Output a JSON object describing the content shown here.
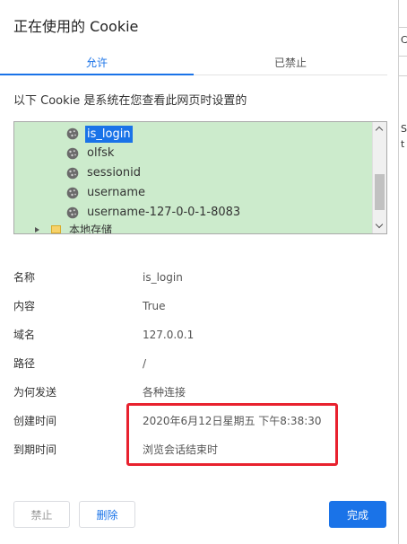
{
  "dialog": {
    "title": "正在使用的 Cookie",
    "tabs": [
      {
        "label": "允许",
        "active": true
      },
      {
        "label": "已禁止",
        "active": false
      }
    ],
    "description": "以下 Cookie 是系统在您查看此网页时设置的"
  },
  "cookie_tree": {
    "items": [
      {
        "label": "is_login",
        "selected": true,
        "icon": "cookie-icon"
      },
      {
        "label": "olfsk",
        "selected": false,
        "icon": "cookie-icon"
      },
      {
        "label": "sessionid",
        "selected": false,
        "icon": "cookie-icon"
      },
      {
        "label": "username",
        "selected": false,
        "icon": "cookie-icon"
      },
      {
        "label": "username-127-0-0-1-8083",
        "selected": false,
        "icon": "cookie-icon"
      }
    ],
    "folder": {
      "label": "本地存储",
      "icon": "folder-icon"
    }
  },
  "details": [
    {
      "key": "名称",
      "value": "is_login"
    },
    {
      "key": "内容",
      "value": "True"
    },
    {
      "key": "域名",
      "value": "127.0.0.1"
    },
    {
      "key": "路径",
      "value": "/"
    },
    {
      "key": "为何发送",
      "value": "各种连接"
    },
    {
      "key": "创建时间",
      "value": "2020年6月12日星期五 下午8:38:30"
    },
    {
      "key": "到期时间",
      "value": "浏览会话结束时"
    }
  ],
  "buttons": {
    "block": "禁止",
    "delete": "删除",
    "done": "完成"
  },
  "edge_fragments": [
    "C",
    "S",
    "t"
  ],
  "colors": {
    "accent": "#1a73e8",
    "tree_background": "#ccebcc",
    "annotation_red": "#e8212e"
  }
}
